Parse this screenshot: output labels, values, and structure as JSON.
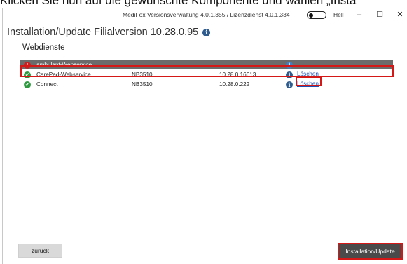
{
  "caption": "Klicken Sie nun auf die gewünschte Komponente und wählen „Insta",
  "window": {
    "title": "MediFox Versionsverwaltung 4.0.1.355 / Lizenzdienst 4.0.1.334",
    "theme_label": "Hell",
    "minimize": "–",
    "maximize": "☐",
    "close": "✕"
  },
  "page": {
    "title": "Installation/Update Filialversion 10.28.0.95",
    "info_icon": "i",
    "section": "Webdienste"
  },
  "services": [
    {
      "status": "error",
      "status_icon": "!",
      "name": "ambulant-Webservice",
      "server": "",
      "version": "",
      "info_icon": "i",
      "action": ""
    },
    {
      "status": "ok",
      "status_icon": "✔",
      "name": "CarePad-Webservice",
      "server": "NB3510",
      "version": "10.28.0.16613",
      "info_icon": "i",
      "action": "Löschen"
    },
    {
      "status": "ok",
      "status_icon": "✔",
      "name": "Connect",
      "server": "NB3510",
      "version": "10.28.0.222",
      "info_icon": "i",
      "action": "Löschen"
    }
  ],
  "buttons": {
    "back": "zurück",
    "install": "Installation/Update"
  },
  "colors": {
    "highlight_outline": "#d41818",
    "selected_row": "#6b6b6b",
    "ok": "#2e9a3f",
    "error": "#cc1f1f",
    "info": "#2f5c8f",
    "link": "#1f4fb5",
    "primary_button": "#4a4a4a"
  },
  "icons": {
    "status_ok": "check-circle-icon",
    "status_error": "exclamation-circle-icon",
    "info": "info-circle-icon",
    "theme": "toggle-switch"
  }
}
